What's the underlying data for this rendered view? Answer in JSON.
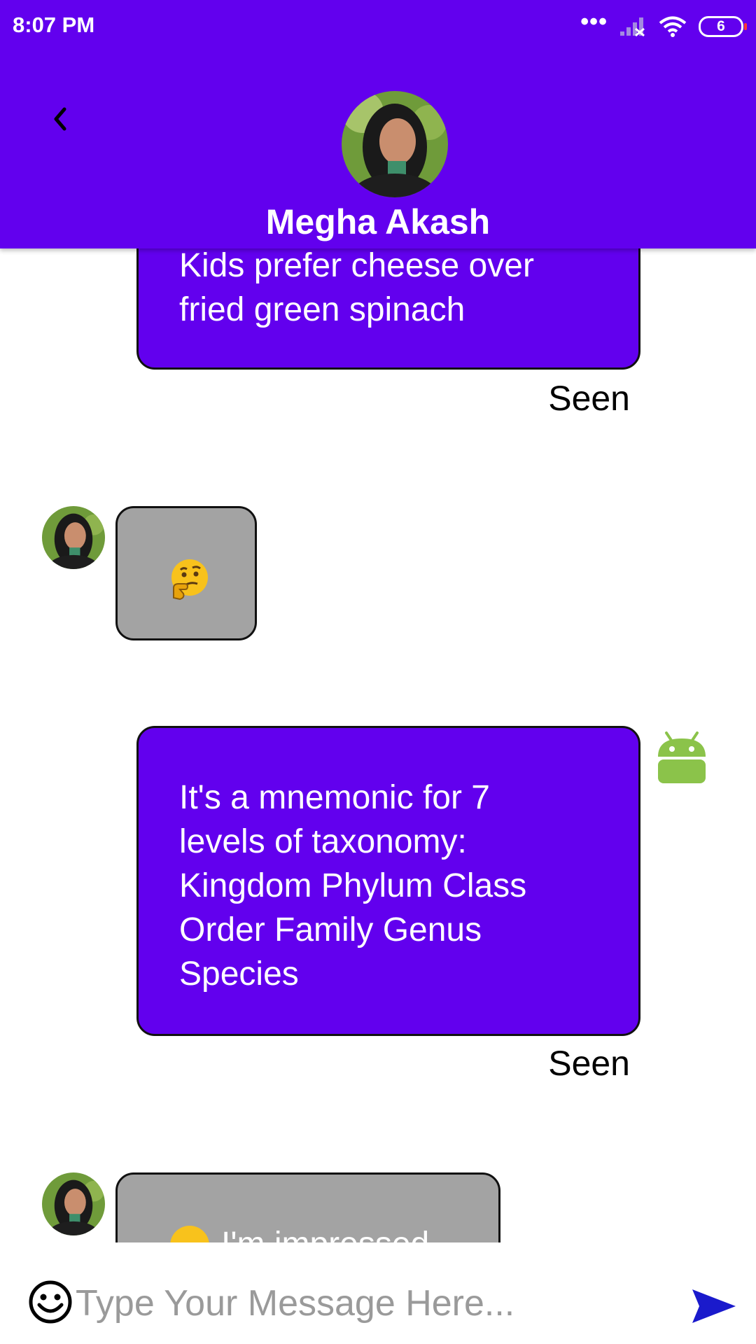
{
  "status_bar": {
    "time": "8:07 PM",
    "dots": "•••",
    "battery_level": "6"
  },
  "header": {
    "contact_name": "Megha Akash",
    "back_icon": "chevron-left-icon",
    "background_color": "#6200ee"
  },
  "messages": [
    {
      "direction": "sent",
      "text": "Kids prefer cheese over\nfried green spinach",
      "status": "Seen"
    },
    {
      "direction": "received",
      "emoji": "thinking-face"
    },
    {
      "direction": "sent",
      "text": "It's a mnemonic for 7\nlevels of taxonomy:\nKingdom Phylum Class\nOrder Family Genus\nSpecies",
      "status": "Seen"
    },
    {
      "direction": "received",
      "text": "I'm impressed"
    }
  ],
  "input": {
    "placeholder": "Type Your Message Here...",
    "value": ""
  },
  "colors": {
    "sent_bubble": "#6200ee",
    "received_bubble": "#a3a3a3",
    "send_icon": "#1a1acc"
  }
}
